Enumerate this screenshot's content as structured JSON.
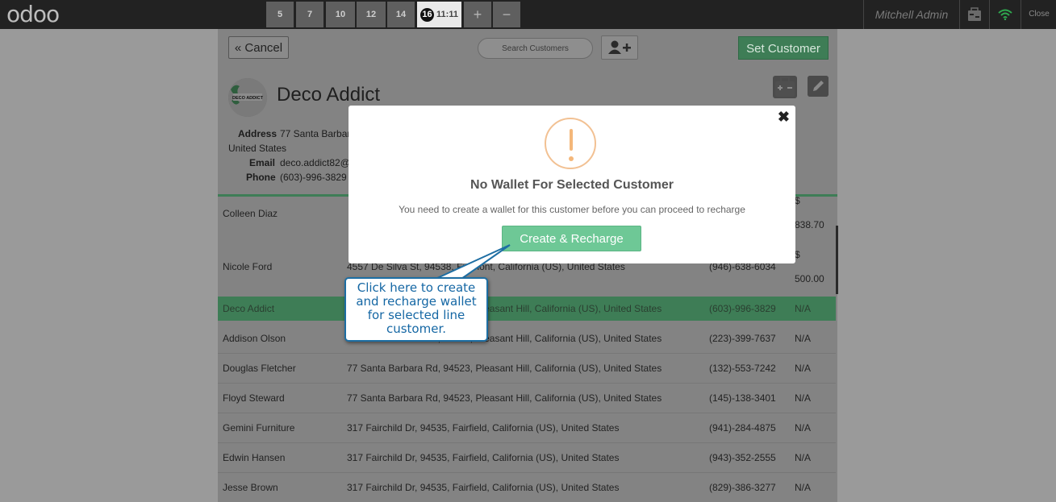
{
  "topbar": {
    "logo": "odoo",
    "orders": [
      {
        "label": "5"
      },
      {
        "label": "7"
      },
      {
        "label": "10"
      },
      {
        "label": "12"
      },
      {
        "label": "14"
      }
    ],
    "active_order": {
      "number": "16",
      "time": "11:11"
    },
    "add_label": "+",
    "remove_label": "−",
    "user": "Mitchell Admin",
    "close_label": "Close"
  },
  "toolbar": {
    "cancel_label": "Cancel",
    "search_placeholder": "Search Customers",
    "set_customer_label": "Set Customer"
  },
  "customer_detail": {
    "name": "Deco Addict",
    "logo_text": "DECO ADDICT",
    "address_label": "Address",
    "address_line1": "77 Santa Barbar",
    "address_line2": "United States",
    "email_label": "Email",
    "email": "deco.addict82@",
    "phone_label": "Phone",
    "phone": "(603)-996-3829"
  },
  "customers": [
    {
      "name": "Colleen Diaz",
      "address": "",
      "phone": "",
      "balance_currency": "$",
      "balance": "838.70"
    },
    {
      "name": "Nicole Ford",
      "address": "4557 De Silva St, 94538, Fremont, California (US), United States",
      "phone": "(946)-638-6034",
      "balance_currency": "$",
      "balance": "500.00"
    },
    {
      "name": "Deco Addict",
      "address": "77 Santa Barbara Rd, 94523, Pleasant Hill, California (US), United States",
      "phone": "(603)-996-3829",
      "balance": "N/A",
      "selected": true
    },
    {
      "name": "Addison Olson",
      "address": "77 Santa Barbara Rd, 94523, Pleasant Hill, California (US), United States",
      "phone": "(223)-399-7637",
      "balance": "N/A"
    },
    {
      "name": "Douglas Fletcher",
      "address": "77 Santa Barbara Rd, 94523, Pleasant Hill, California (US), United States",
      "phone": "(132)-553-7242",
      "balance": "N/A"
    },
    {
      "name": "Floyd Steward",
      "address": "77 Santa Barbara Rd, 94523, Pleasant Hill, California (US), United States",
      "phone": "(145)-138-3401",
      "balance": "N/A"
    },
    {
      "name": "Gemini Furniture",
      "address": "317 Fairchild Dr, 94535, Fairfield, California (US), United States",
      "phone": "(941)-284-4875",
      "balance": "N/A"
    },
    {
      "name": "Edwin Hansen",
      "address": "317 Fairchild Dr, 94535, Fairfield, California (US), United States",
      "phone": "(943)-352-2555",
      "balance": "N/A"
    },
    {
      "name": "Jesse Brown",
      "address": "317 Fairchild Dr, 94535, Fairfield, California (US), United States",
      "phone": "(829)-386-3277",
      "balance": "N/A"
    }
  ],
  "modal": {
    "close_symbol": "✖",
    "title": "No Wallet For Selected Customer",
    "message": "You need to create a wallet for this customer before you can proceed to recharge",
    "create_label": "Create & Recharge"
  },
  "callout": {
    "text": "Click here to create and recharge wallet for selected line customer."
  },
  "colors": {
    "accent_green": "#6ec896",
    "dim_green": "#3e7d56",
    "warning": "#f4b77a",
    "callout_blue": "#1567a4"
  }
}
